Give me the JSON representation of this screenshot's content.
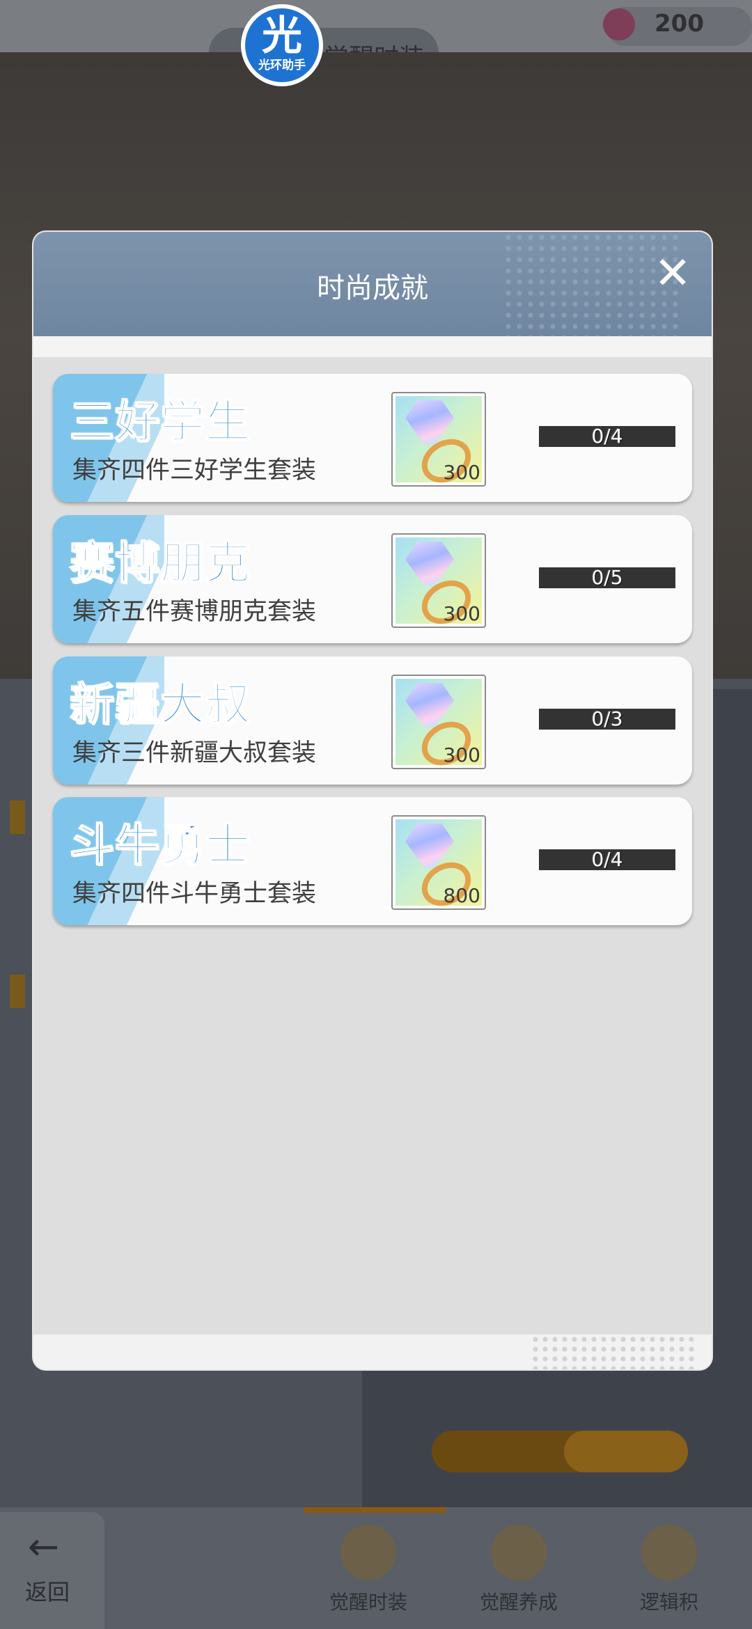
{
  "background": {
    "top_title": "觉醒时装",
    "coin_value": "200",
    "back_label": "返回",
    "bottom_tabs": [
      "觉醒时装",
      "觉醒养成",
      "逻辑积"
    ]
  },
  "badge": {
    "glyph": "光",
    "text": "光环助手"
  },
  "modal": {
    "title": "时尚成就",
    "close_icon": "close-icon"
  },
  "achievements": [
    {
      "name": "三好学生",
      "description": "集齐四件三好学生套装",
      "reward_amount": "300",
      "progress": "0/4",
      "reward_icon": "gem-ring-icon"
    },
    {
      "name": "赛博朋克",
      "description": "集齐五件赛博朋克套装",
      "reward_amount": "300",
      "progress": "0/5",
      "reward_icon": "gem-ring-icon"
    },
    {
      "name": "新疆大叔",
      "description": "集齐三件新疆大叔套装",
      "reward_amount": "300",
      "progress": "0/3",
      "reward_icon": "gem-ring-icon"
    },
    {
      "name": "斗牛勇士",
      "description": "集齐四件斗牛勇士套装",
      "reward_amount": "800",
      "progress": "0/4",
      "reward_icon": "gem-ring-icon"
    }
  ],
  "colors": {
    "header": "#7a90aa",
    "title_blue": "#3c8fdc",
    "progress_bar": "#333333"
  }
}
